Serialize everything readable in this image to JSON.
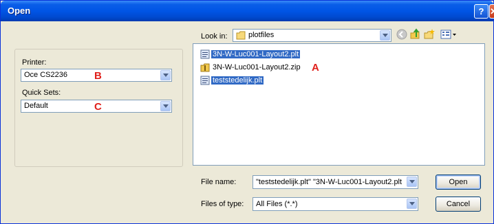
{
  "window": {
    "title": "Open"
  },
  "look_in": {
    "label": "Look in:",
    "value": "plotfiles"
  },
  "left_panel": {
    "printer_label": "Printer:",
    "printer_value": "Oce CS2236",
    "quicksets_label": "Quick Sets:",
    "quicksets_value": "Default"
  },
  "annotations": {
    "a": "A",
    "b": "B",
    "c": "C"
  },
  "files": [
    {
      "name": "3N-W-Luc001-Layout2.plt",
      "icon": "plot-file-icon",
      "selected": true
    },
    {
      "name": "3N-W-Luc001-Layout2.zip",
      "icon": "zip-folder-icon",
      "selected": false
    },
    {
      "name": "teststedelijk.plt",
      "icon": "plot-file-icon",
      "selected": true
    }
  ],
  "file_name": {
    "label": "File name:",
    "value": "\"teststedelijk.plt\" \"3N-W-Luc001-Layout2.plt"
  },
  "file_type": {
    "label": "Files of type:",
    "value": "All Files (*.*)"
  },
  "buttons": {
    "open": "Open",
    "cancel": "Cancel"
  },
  "colors": {
    "selection": "#316ac5",
    "titlebar": "#0055e5",
    "annotation": "#e0201b"
  }
}
